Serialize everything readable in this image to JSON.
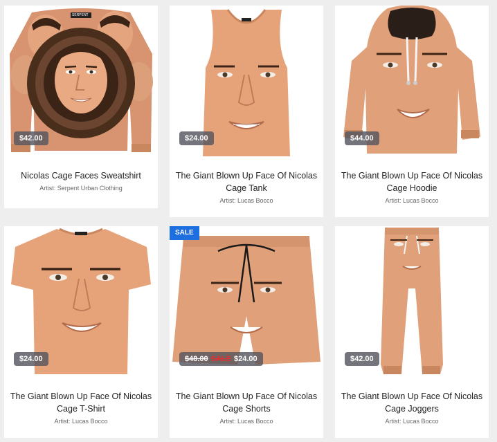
{
  "colors": {
    "skin": "#e6a279",
    "skin_shade": "#c98760",
    "hair": "#3b2416",
    "price_badge": "#55555f",
    "sale_badge": "#1d6fe0",
    "sale_text": "#e0312f"
  },
  "products": [
    {
      "title": "Nicolas Cage Faces Sweatshirt",
      "artist": "Artist: Serpent Urban Clothing",
      "price": "$42.00",
      "brand_tag": "SERPENT",
      "garment": "sweatshirt"
    },
    {
      "title": "The Giant Blown Up Face Of Nicolas Cage Tank",
      "artist": "Artist: Lucas Bocco",
      "price": "$24.00",
      "garment": "tank"
    },
    {
      "title": "The Giant Blown Up Face Of Nicolas Cage Hoodie",
      "artist": "Artist: Lucas Bocco",
      "price": "$44.00",
      "garment": "hoodie"
    },
    {
      "title": "The Giant Blown Up Face Of Nicolas Cage T-Shirt",
      "artist": "Artist: Lucas Bocco",
      "price": "$24.00",
      "garment": "tshirt"
    },
    {
      "title": "The Giant Blown Up Face Of Nicolas Cage Shorts",
      "artist": "Artist: Lucas Bocco",
      "old_price": "$48.00",
      "sale_word": "SALE",
      "price": "$24.00",
      "badge": "SALE",
      "garment": "shorts"
    },
    {
      "title": "The Giant Blown Up Face Of Nicolas Cage Joggers",
      "artist": "Artist: Lucas Bocco",
      "price": "$42.00",
      "garment": "joggers"
    }
  ]
}
